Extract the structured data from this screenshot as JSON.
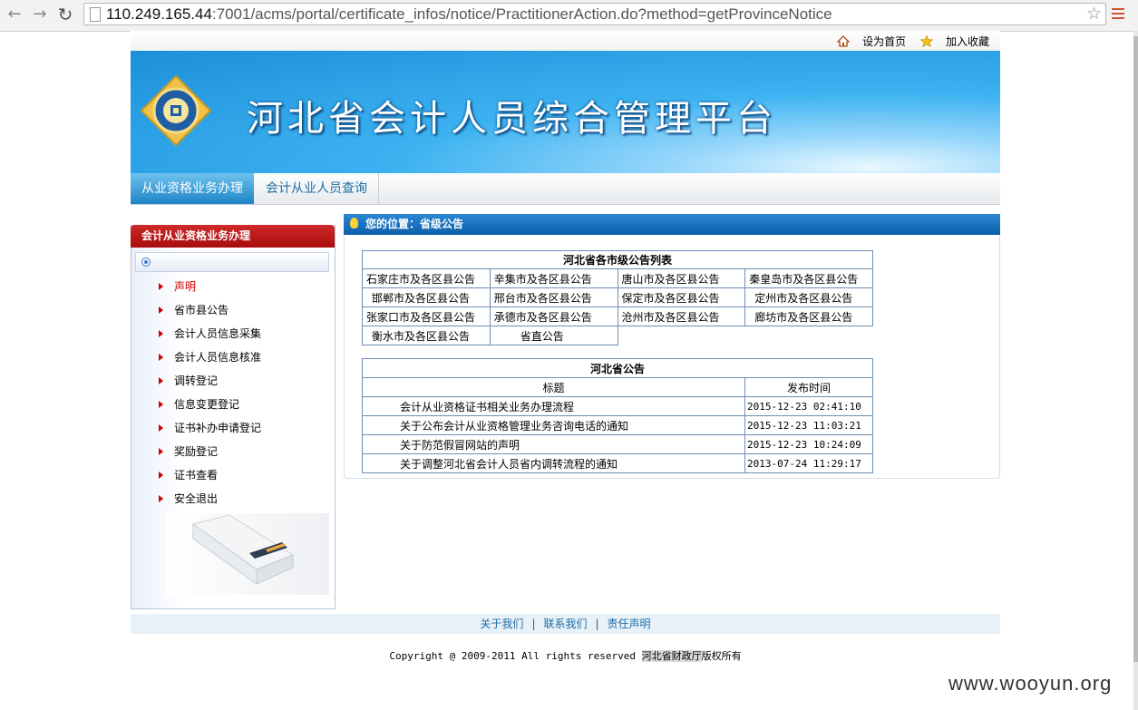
{
  "browser": {
    "url_host": "110.249.165.44",
    "url_rest": ":7001/acms/portal/certificate_infos/notice/PractitionerAction.do?method=getProvinceNotice"
  },
  "top_links": {
    "home": "设为首页",
    "favorite": "加入收藏"
  },
  "banner": {
    "title": "河北省会计人员综合管理平台"
  },
  "nav": {
    "tab1": "从业资格业务办理",
    "tab2": "会计从业人员查询"
  },
  "sidebar": {
    "header": "会计从业资格业务办理",
    "items": [
      "声明",
      "省市县公告",
      "会计人员信息采集",
      "会计人员信息核准",
      "调转登记",
      "信息变更登记",
      "证书补办申请登记",
      "奖励登记",
      "证书查看",
      "安全退出"
    ]
  },
  "breadcrumb": "您的位置：省级公告",
  "city_table": {
    "title": "河北省各市级公告列表",
    "cells": [
      "石家庄市及各区县公告",
      "辛集市及各区县公告",
      "唐山市及各区县公告",
      "秦皇岛市及各区县公告",
      "邯郸市及各区县公告",
      "邢台市及各区县公告",
      "保定市及各区县公告",
      "定州市及各区县公告",
      "张家口市及各区县公告",
      "承德市及各区县公告",
      "沧州市及各区县公告",
      "廊坊市及各区县公告",
      "衡水市及各区县公告",
      "省直公告"
    ]
  },
  "notice_table": {
    "title": "河北省公告",
    "col_title": "标题",
    "col_time": "发布时间",
    "rows": [
      {
        "title": "会计从业资格证书相关业务办理流程",
        "time": "2015-12-23 02:41:10"
      },
      {
        "title": "关于公布会计从业资格管理业务咨询电话的通知",
        "time": "2015-12-23 11:03:21"
      },
      {
        "title": "关于防范假冒网站的声明",
        "time": "2015-12-23 10:24:09"
      },
      {
        "title": "关于调整河北省会计人员省内调转流程的通知",
        "time": "2013-07-24 11:29:17"
      }
    ]
  },
  "footer": {
    "about": "关于我们",
    "contact": "联系我们",
    "disclaimer": "责任声明",
    "sep": "|"
  },
  "copyright": {
    "text": "Copyright @ 2009-2011 All rights reserved ",
    "org": "河北省财政厅",
    "suffix": "版权所有"
  },
  "watermark": "www.wooyun.org",
  "colors": {
    "accent_blue": "#1e84c6",
    "sidebar_red": "#b81414",
    "link_blue": "#1e6fa8"
  }
}
